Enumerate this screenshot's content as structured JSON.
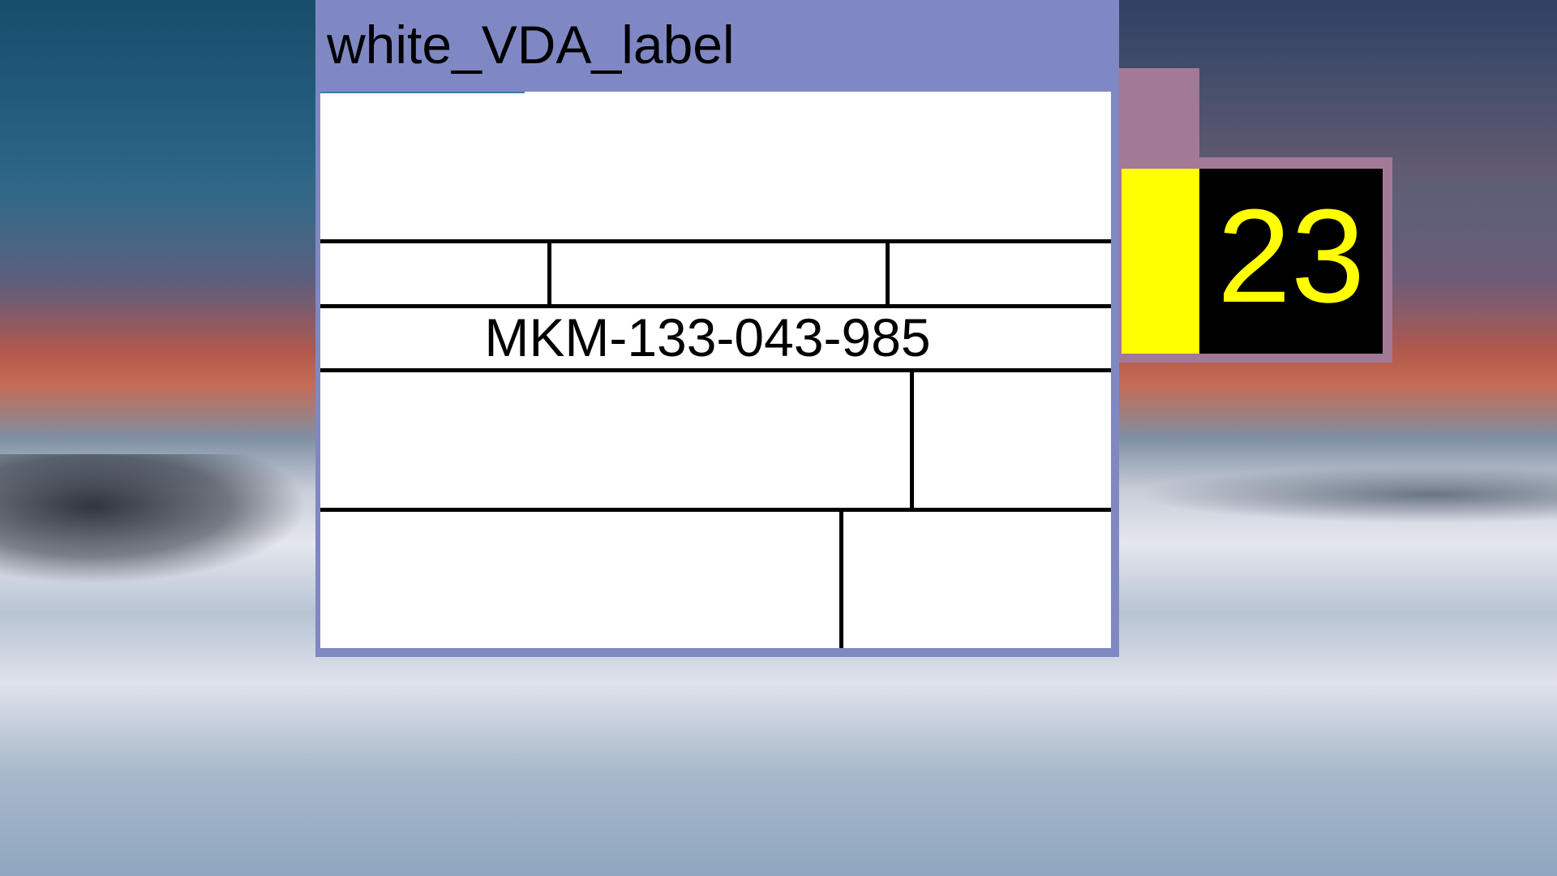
{
  "window": {
    "title": "white_VDA_label"
  },
  "label": {
    "part_number": "MKM-133-043-985"
  },
  "counter": {
    "value": "23",
    "text_color": "#ffff00",
    "indicator_color": "#ffff00"
  },
  "colors": {
    "window_frame": "#8088c4",
    "counter_frame": "#a27a96",
    "label_background": "#ffffff"
  }
}
